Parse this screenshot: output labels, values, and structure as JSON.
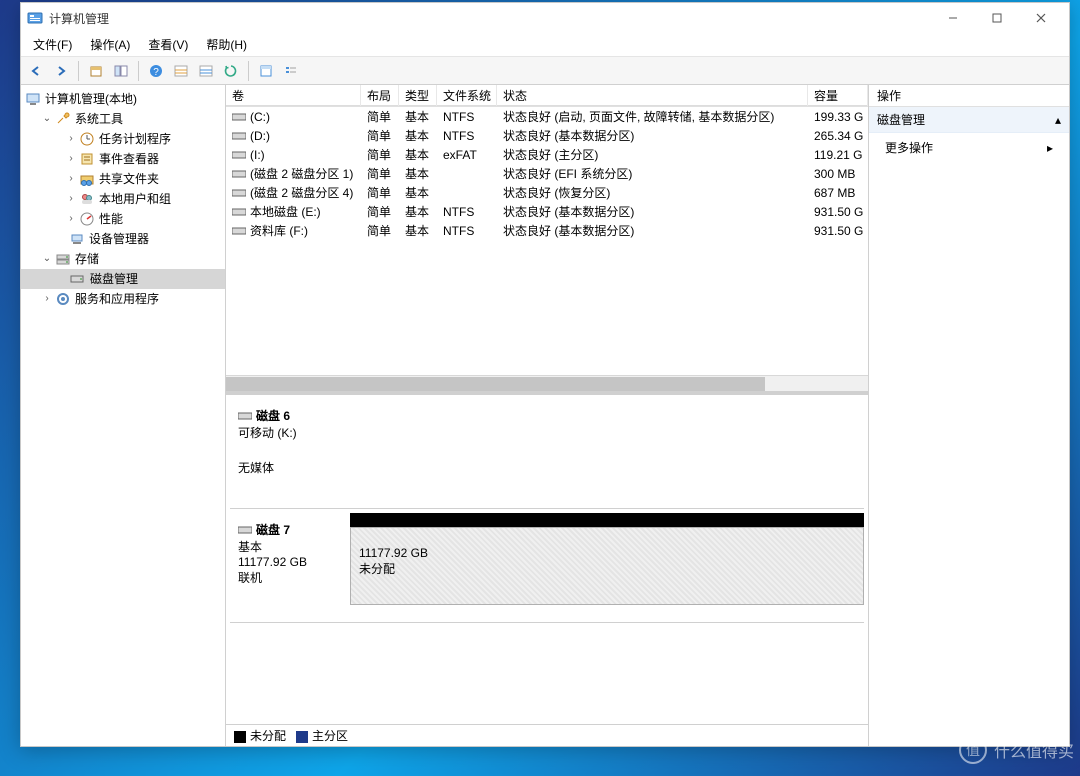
{
  "window": {
    "title": "计算机管理"
  },
  "menubar": [
    "文件(F)",
    "操作(A)",
    "查看(V)",
    "帮助(H)"
  ],
  "tree": {
    "root": "计算机管理(本地)",
    "system_tools": {
      "label": "系统工具",
      "children": [
        "任务计划程序",
        "事件查看器",
        "共享文件夹",
        "本地用户和组",
        "性能",
        "设备管理器"
      ]
    },
    "storage": {
      "label": "存储",
      "children": [
        "磁盘管理"
      ]
    },
    "services_apps": "服务和应用程序"
  },
  "volumes": {
    "columns": [
      "卷",
      "布局",
      "类型",
      "文件系统",
      "状态",
      "容量"
    ],
    "rows": [
      {
        "name": "(C:)",
        "layout": "简单",
        "type": "基本",
        "fs": "NTFS",
        "status": "状态良好 (启动, 页面文件, 故障转储, 基本数据分区)",
        "capacity": "199.33 G"
      },
      {
        "name": "(D:)",
        "layout": "简单",
        "type": "基本",
        "fs": "NTFS",
        "status": "状态良好 (基本数据分区)",
        "capacity": "265.34 G"
      },
      {
        "name": "(I:)",
        "layout": "简单",
        "type": "基本",
        "fs": "exFAT",
        "status": "状态良好 (主分区)",
        "capacity": "119.21 G"
      },
      {
        "name": "(磁盘 2 磁盘分区 1)",
        "layout": "简单",
        "type": "基本",
        "fs": "",
        "status": "状态良好 (EFI 系统分区)",
        "capacity": "300 MB"
      },
      {
        "name": "(磁盘 2 磁盘分区 4)",
        "layout": "简单",
        "type": "基本",
        "fs": "",
        "status": "状态良好 (恢复分区)",
        "capacity": "687 MB"
      },
      {
        "name": "本地磁盘 (E:)",
        "layout": "简单",
        "type": "基本",
        "fs": "NTFS",
        "status": "状态良好 (基本数据分区)",
        "capacity": "931.50 G"
      },
      {
        "name": "资料库 (F:)",
        "layout": "简单",
        "type": "基本",
        "fs": "NTFS",
        "status": "状态良好 (基本数据分区)",
        "capacity": "931.50 G"
      }
    ]
  },
  "disks": [
    {
      "name": "磁盘 6",
      "line1": "可移动 (K:)",
      "line2": "无媒体"
    },
    {
      "name": "磁盘 7",
      "line1": "基本",
      "line2": "11177.92 GB",
      "line3": "联机",
      "part_size": "11177.92 GB",
      "part_status": "未分配"
    }
  ],
  "legend": [
    "未分配",
    "主分区"
  ],
  "actions": {
    "header": "操作",
    "category": "磁盘管理",
    "more": "更多操作"
  },
  "watermark": "什么值得买"
}
